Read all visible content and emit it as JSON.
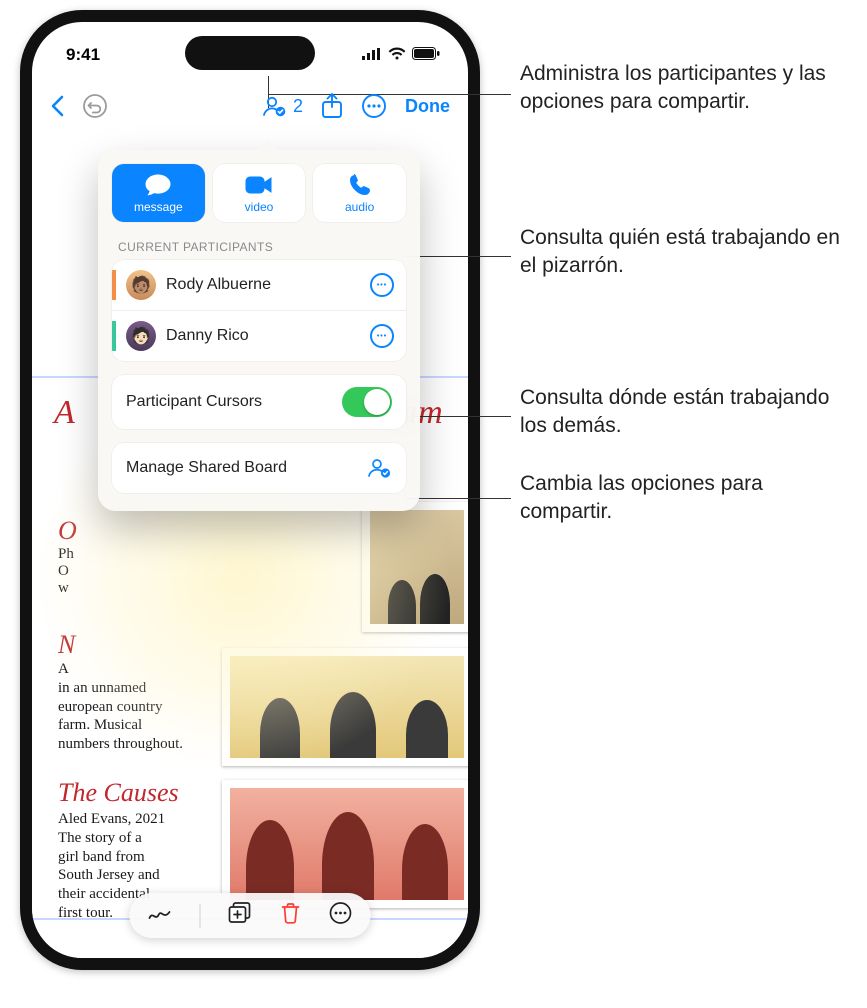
{
  "status": {
    "time": "9:41"
  },
  "toolbar": {
    "participant_count": "2",
    "done_label": "Done"
  },
  "popover": {
    "actions": {
      "message": "message",
      "video": "video",
      "audio": "audio"
    },
    "section_title": "CURRENT PARTICIPANTS",
    "participants": [
      {
        "name": "Rody Albuerne",
        "presence_color": "#f58e4a"
      },
      {
        "name": "Danny Rico",
        "presence_color": "#37c79b"
      }
    ],
    "cursors_label": "Participant Cursors",
    "cursors_on": true,
    "manage_label": "Manage Shared Board"
  },
  "board": {
    "title_fragment_left": "A",
    "title_fragment_right": "eam",
    "section1_head": "O",
    "section1_body": "Ph\nO\nw",
    "section2_head": "N",
    "section2_body": "A\nin an unnamed\neuropean country\nfarm. Musical\nnumbers throughout.",
    "section3_head": "The Causes",
    "section3_body": "Aled Evans, 2021\nThe story of a\ngirl band from\nSouth Jersey and\ntheir accidental\nfirst tour."
  },
  "callouts": {
    "c1": "Administra los participantes y las opciones para compartir.",
    "c2": "Consulta quién está trabajando en el pizarrón.",
    "c3": "Consulta dónde están trabajando los demás.",
    "c4": "Cambia las opciones para compartir."
  }
}
